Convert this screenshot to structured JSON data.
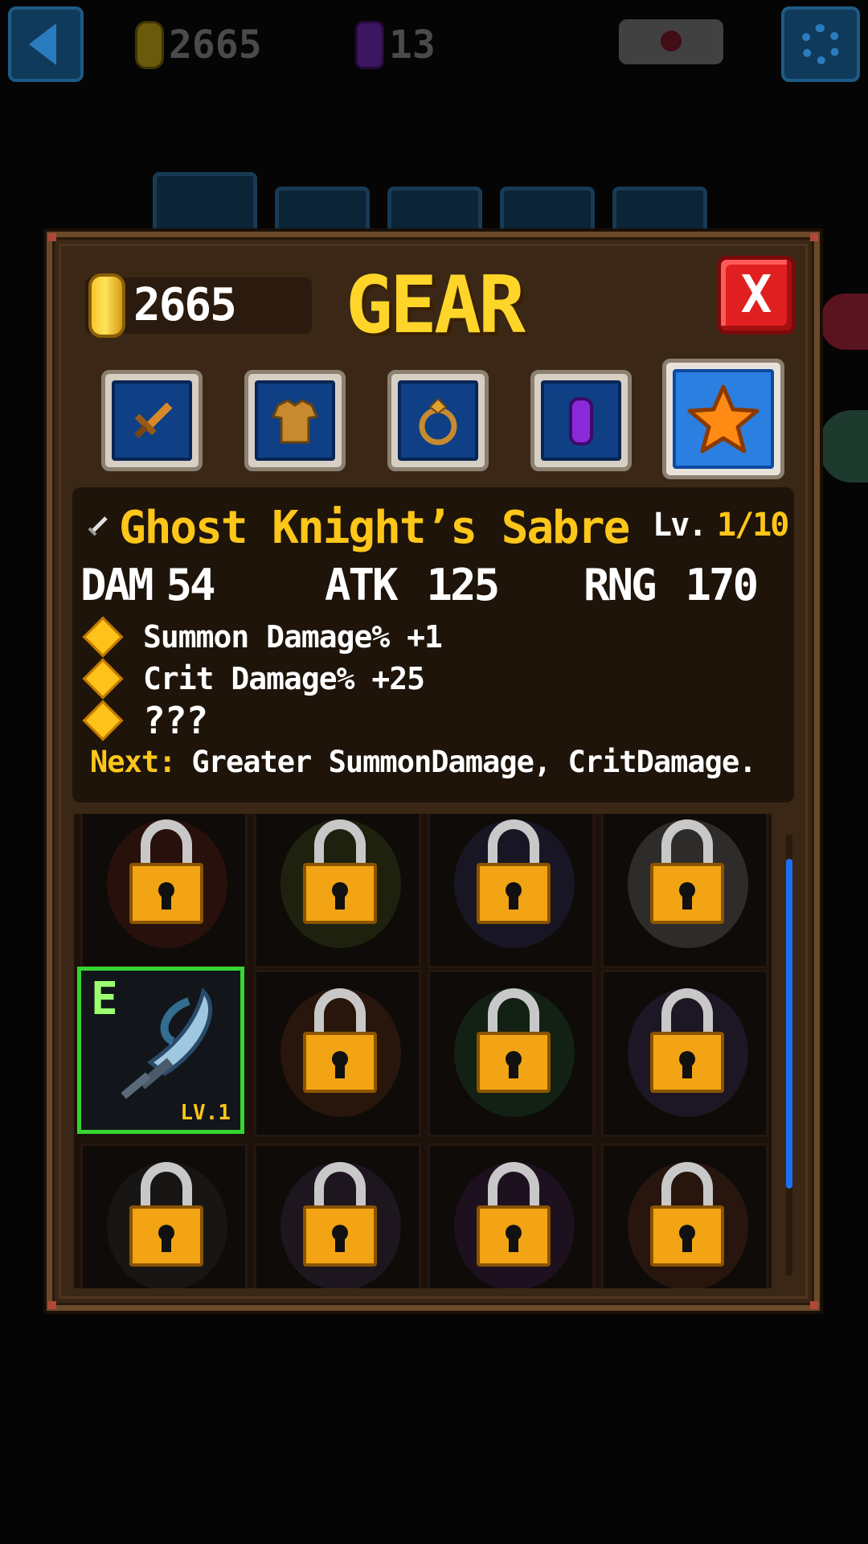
{
  "topbar": {
    "coins": "2665",
    "gems": "13",
    "back_icon": "back-arrow-icon",
    "settings_icon": "gear-icon",
    "scroll_icon": "scroll-icon"
  },
  "panel": {
    "coins": "2665",
    "title": "GEAR",
    "close_label": "X",
    "categories": [
      {
        "name": "weapon",
        "icon": "sword-icon"
      },
      {
        "name": "armor",
        "icon": "shirt-icon"
      },
      {
        "name": "ring",
        "icon": "ring-icon"
      },
      {
        "name": "gem",
        "icon": "purple-gem-icon"
      },
      {
        "name": "special",
        "icon": "star-icon",
        "active": true
      }
    ]
  },
  "item": {
    "name": "Ghost Knight’s Sabre",
    "level_label": "Lv.",
    "level_value": "1/10",
    "stats": [
      {
        "key": "DAM",
        "value": "54"
      },
      {
        "key": "ATK",
        "value": "125"
      },
      {
        "key": "RNG",
        "value": "170"
      }
    ],
    "perks": [
      "Summon Damage% +1",
      "Crit Damage% +25",
      "???"
    ],
    "next_key": "Next:",
    "next_value": "Greater SummonDamage, CritDamage."
  },
  "grid": {
    "equipped_badge": "E",
    "equipped_level": "LV.1"
  },
  "colors": {
    "accent_gold": "#ffc61a",
    "panel_brown": "#3a2715",
    "close_red": "#e02020",
    "equipped_green": "#35d630",
    "scroll_blue": "#1d6ff5"
  }
}
